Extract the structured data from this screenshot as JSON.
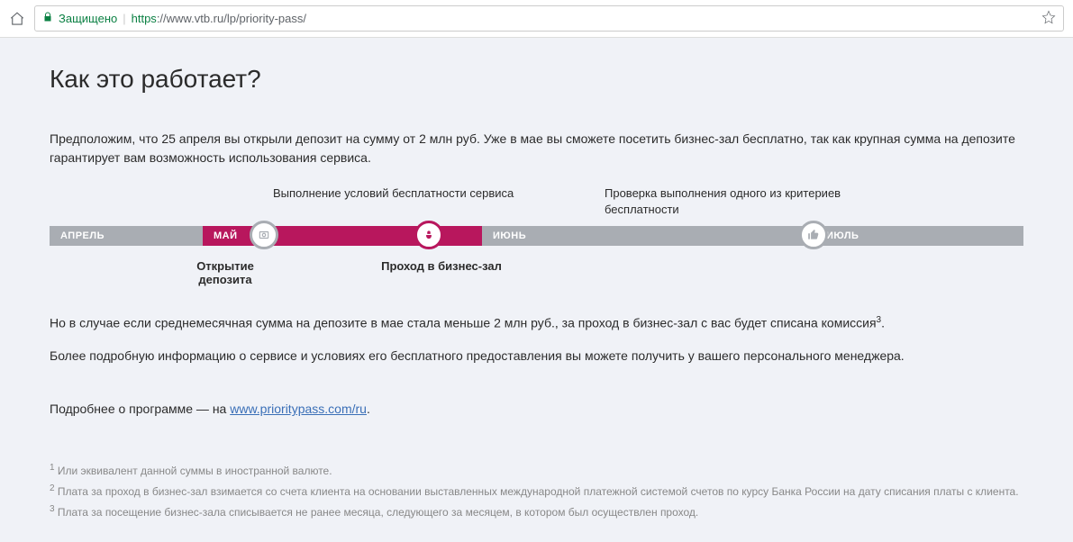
{
  "browser": {
    "secure": "Защищено",
    "url_https": "https",
    "url_rest": "://www.vtb.ru/lp/priority-pass/"
  },
  "page": {
    "heading": "Как это работает?",
    "para1": "Предположим, что 25 апреля вы открыли депозит на сумму от 2 млн руб. Уже в мае вы сможете посетить бизнес-зал бесплатно, так как крупная сумма на депозите гарантирует вам возможность использования сервиса.",
    "para2_a": "Но в случае если среднемесячная сумма на депозите в мае стала меньше 2 млн руб., за проход в бизнес-зал с вас будет списана комиссия",
    "para2_sup": "3",
    "para2_b": ".",
    "para3": "Более подробную информацию о сервисе и условиях его бесплатного предоставления вы можете получить у вашего персонального менеджера.",
    "more_prefix": "Подробнее о программе — на  ",
    "more_link": "www.prioritypass.com/ru",
    "more_suffix": "."
  },
  "timeline": {
    "top_label1": "Выполнение условий бесплатности сервиса",
    "top_label2": "Проверка выполнения одного из критериев бесплатности",
    "april": "АПРЕЛЬ",
    "may": "МАЙ",
    "june": "ИЮНЬ",
    "july": "ИЮЛЬ",
    "bottom1": "Открытие депозита",
    "bottom2": "Проход в бизнес-зал"
  },
  "footnotes": {
    "f1_num": "1",
    "f1_text": " Или эквивалент данной суммы в иностранной валюте.",
    "f2_num": "2",
    "f2_text": " Плата за проход в бизнес-зал взимается со счета клиента на основании выставленных международной платежной системой счетов по курсу Банка России на дату списания платы с клиента.",
    "f3_num": "3",
    "f3_text": " Плата за посещение бизнес-зала списывается не ранее месяца, следующего за месяцем, в котором был осуществлен проход."
  }
}
